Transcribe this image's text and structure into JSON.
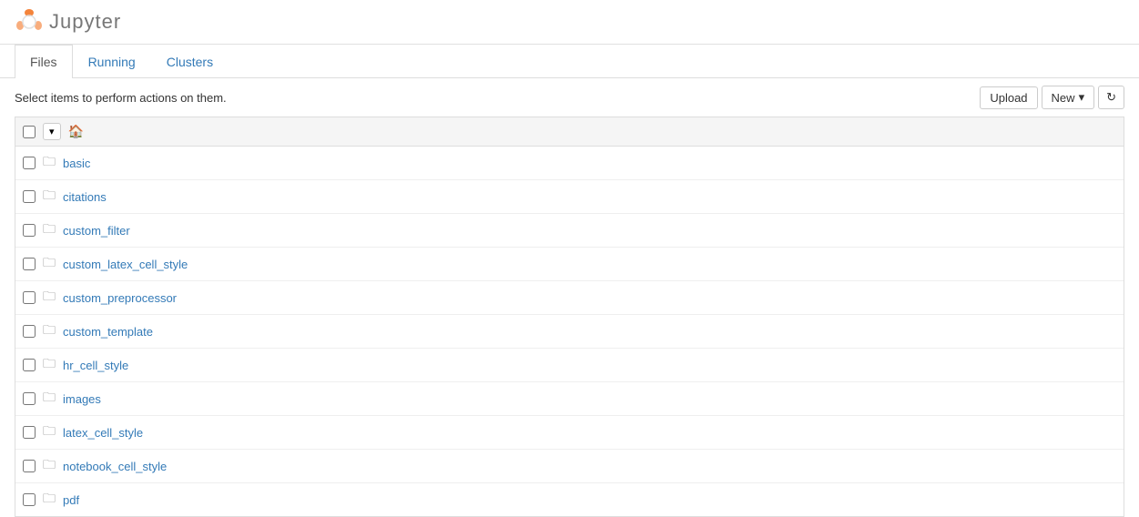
{
  "app": {
    "title": "Jupyter",
    "logo_alt": "Jupyter logo"
  },
  "tabs": [
    {
      "label": "Files",
      "active": true
    },
    {
      "label": "Running",
      "active": false
    },
    {
      "label": "Clusters",
      "active": false
    }
  ],
  "toolbar": {
    "select_hint": "Select items to perform actions on them.",
    "upload_label": "Upload",
    "new_label": "New",
    "new_arrow": "▾",
    "refresh_icon": "↻"
  },
  "file_list": {
    "home_icon": "🏠",
    "files": [
      {
        "name": "basic",
        "type": "folder"
      },
      {
        "name": "citations",
        "type": "folder"
      },
      {
        "name": "custom_filter",
        "type": "folder"
      },
      {
        "name": "custom_latex_cell_style",
        "type": "folder"
      },
      {
        "name": "custom_preprocessor",
        "type": "folder"
      },
      {
        "name": "custom_template",
        "type": "folder"
      },
      {
        "name": "hr_cell_style",
        "type": "folder"
      },
      {
        "name": "images",
        "type": "folder"
      },
      {
        "name": "latex_cell_style",
        "type": "folder"
      },
      {
        "name": "notebook_cell_style",
        "type": "folder"
      },
      {
        "name": "pdf",
        "type": "folder"
      }
    ]
  }
}
